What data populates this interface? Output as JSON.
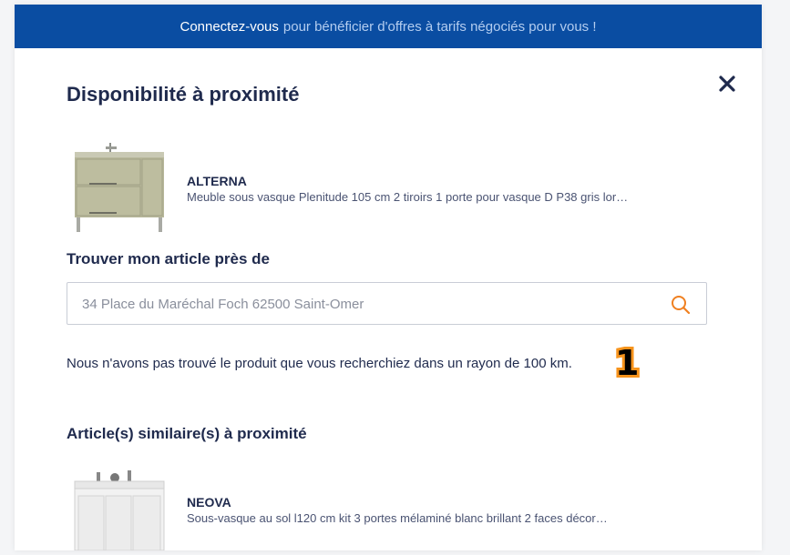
{
  "banner": {
    "link": "Connectez-vous",
    "text": "pour bénéficier d'offres à tarifs négociés pour vous !"
  },
  "modal": {
    "title": "Disponibilité à proximité",
    "close_icon": "close-icon"
  },
  "product": {
    "brand": "ALTERNA",
    "description": "Meuble sous vasque Plenitude 105 cm 2 tiroirs 1 porte pour vasque D P38 gris lor…",
    "image_icon": "vanity-cabinet-image"
  },
  "search": {
    "label": "Trouver mon article près de",
    "value": "34 Place du Maréchal Foch 62500 Saint-Omer",
    "icon": "search-icon"
  },
  "result": {
    "message": "Nous n'avons pas trouvé le produit que vous recherchiez dans un rayon de 100 km.",
    "marker": "1"
  },
  "similar": {
    "label": "Article(s) similaire(s) à proximité",
    "items": [
      {
        "brand": "NEOVA",
        "description": "Sous-vasque au sol l120 cm kit 3 portes mélaminé blanc brillant 2 faces décor…"
      }
    ]
  },
  "colors": {
    "banner_bg": "#0a4da2",
    "title": "#1f2a4d",
    "accent_orange": "#f7941d"
  }
}
